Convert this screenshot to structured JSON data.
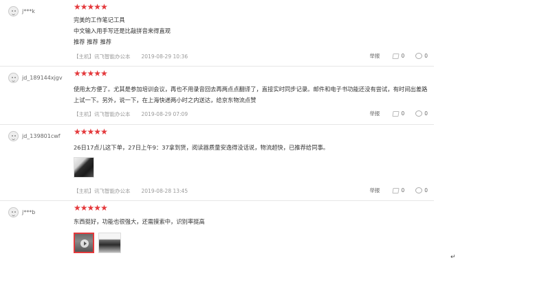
{
  "reviews": [
    {
      "user": "j***k",
      "stars": 5,
      "lines": [
        "完美的工作笔记工具",
        "中文输入用手写还是比敲拼音来得直观",
        "推荐 推荐 推荐"
      ],
      "product": "【主机】讯飞智能办公本",
      "date": "2019-08-29 10:36",
      "report": "举报",
      "likes": "0",
      "replies": "0"
    },
    {
      "user": "jd_189144xjgv",
      "stars": 5,
      "lines": [
        "使用太方便了。尤其是参加培训会议，再也不用录音回去再两点点翻译了，直接实时同步记录。邮件和电子书功能还没有尝试，有时间出差路上试一下。另外，说一下，在上海快递两小时之内送达，给京东物流点赞"
      ],
      "product": "【主机】讯飞智能办公本",
      "date": "2019-08-29 07:09",
      "report": "举报",
      "likes": "0",
      "replies": "0"
    },
    {
      "user": "jd_139801cwf",
      "stars": 5,
      "lines": [
        "26日17点儿这下单，27日上午9：37拿到货，阅读器质量安逸得没话说，物流超快，已推荐给同事。"
      ],
      "product": "【主机】讯飞智能办公本",
      "date": "2019-08-28 13:45",
      "report": "举报",
      "likes": "0",
      "replies": "0"
    },
    {
      "user": "j***b",
      "stars": 5,
      "lines": [
        "东西挺好，功能也很强大，还需摸索中，识别率挺高"
      ]
    }
  ],
  "star_color": "#e4393c",
  "paragraph_mark": "↵"
}
